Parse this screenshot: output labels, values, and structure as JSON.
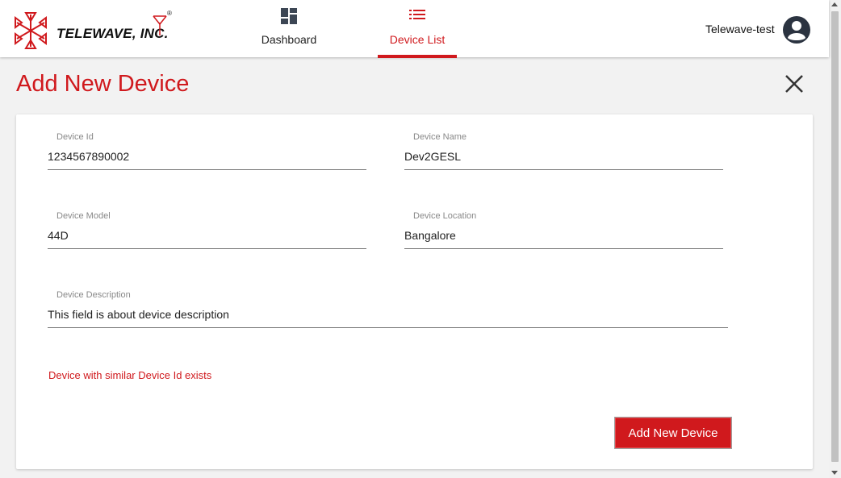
{
  "header": {
    "logo_text": "TELEWAVE, INC.",
    "logo_reg_mark": "®",
    "tabs": [
      {
        "label": "Dashboard",
        "icon": "dashboard-icon"
      },
      {
        "label": "Device List",
        "icon": "list-icon",
        "active": true
      }
    ],
    "user_name": "Telewave-test",
    "avatar_icon": "account-circle-icon"
  },
  "page": {
    "title": "Add New Device",
    "close_icon": "close-icon"
  },
  "form": {
    "device_id": {
      "label": "Device Id",
      "value": "1234567890002"
    },
    "device_name": {
      "label": "Device Name",
      "value": "Dev2GESL"
    },
    "device_model": {
      "label": "Device Model",
      "value": "44D"
    },
    "device_location": {
      "label": "Device Location",
      "value": "Bangalore"
    },
    "device_description": {
      "label": "Device Description",
      "value": "This field is about device description"
    },
    "error": "Device with similar Device Id exists",
    "submit_label": "Add New Device"
  },
  "colors": {
    "accent": "#d0191d",
    "background": "#f2f2f2",
    "card": "#ffffff"
  }
}
